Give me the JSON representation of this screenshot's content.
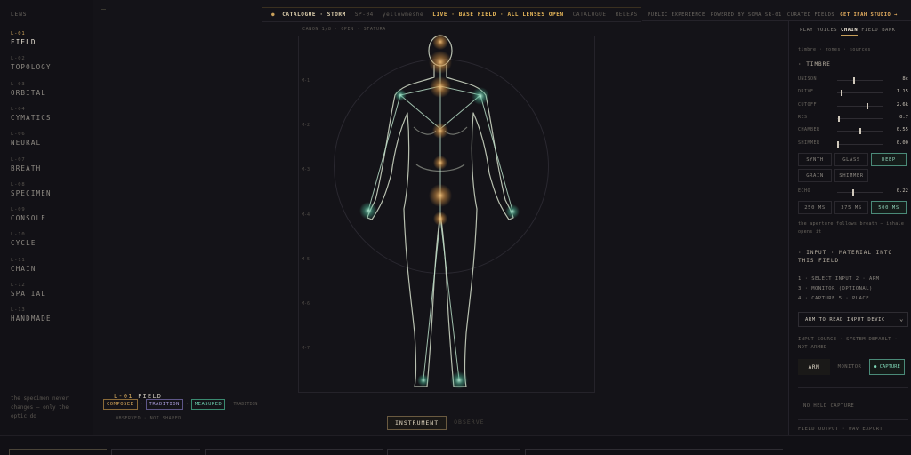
{
  "sidebar": {
    "heading": "LENS",
    "lenses": [
      {
        "code": "L-01",
        "name": "FIELD",
        "active": true
      },
      {
        "code": "L-02",
        "name": "TOPOLOGY"
      },
      {
        "code": "L-03",
        "name": "ORBITAL"
      },
      {
        "code": "L-04",
        "name": "CYMATICS"
      },
      {
        "code": "L-06",
        "name": "NEURAL"
      },
      {
        "code": "L-07",
        "name": "BREATH"
      },
      {
        "code": "L-08",
        "name": "SPECIMEN"
      },
      {
        "code": "L-09",
        "name": "CONSOLE"
      },
      {
        "code": "L-10",
        "name": "CYCLE"
      },
      {
        "code": "L-11",
        "name": "CHAIN"
      },
      {
        "code": "L-12",
        "name": "SPATIAL"
      },
      {
        "code": "L-13",
        "name": "HANDMADE"
      }
    ],
    "note": "the specimen never changes — only the optic do"
  },
  "topbar": {
    "catalogue": "CATALOGUE · STORM",
    "code": "SP-04",
    "tag": "yellowmeshe",
    "live": "LIVE · BASE FIELD · ALL LENSES OPEN",
    "catalogue_link": "CATALOGUE",
    "release": "RELEAS"
  },
  "rightbar": {
    "public": "PUBLIC EXPERIENCE",
    "powered": "POWERED BY SOMA SR-01",
    "curated": "CURATED FIELDS",
    "get": "GET IFAH STUDIO →"
  },
  "stage": {
    "canon": "CANON 1/8 · OPEN · STATURA",
    "ticks": [
      "M-1",
      "M-2",
      "M-3",
      "M-4",
      "M-5",
      "M-6",
      "M-7"
    ]
  },
  "legend": {
    "code": "L-01",
    "name": "FIELD",
    "chips": [
      "COMPOSED",
      "TRADITION",
      "MEASURED"
    ],
    "extra": "TRADITION",
    "sub": "OBSERVED · NOT SHAPED"
  },
  "modes": {
    "instrument": "INSTRUMENT",
    "observe": "OBSERVE"
  },
  "panel": {
    "tabs": [
      "PLAY",
      "VOICES",
      "CHAIN",
      "FIELD",
      "BANK"
    ],
    "active_tab": "CHAIN",
    "crumb": "timbre · zones · sources",
    "timbre_title": "· TIMBRE",
    "sliders": [
      {
        "label": "UNISON",
        "value": "8c",
        "pos": 0.36
      },
      {
        "label": "DRIVE",
        "value": "1.15",
        "pos": 0.08
      },
      {
        "label": "CUTOFF",
        "value": "2.6k",
        "pos": 0.66
      },
      {
        "label": "RES",
        "value": "0.7",
        "pos": 0.02
      },
      {
        "label": "CHAMBER",
        "value": "0.55",
        "pos": 0.5
      },
      {
        "label": "SHIMMER",
        "value": "0.00",
        "pos": 0.0
      }
    ],
    "wave_buttons": [
      "SYNTH",
      "GLASS",
      "DEEP"
    ],
    "wave_active": "DEEP",
    "wave_buttons2": [
      "GRAIN",
      "SHIMMER"
    ],
    "echo": {
      "label": "ECHO",
      "value": "0.22",
      "pos": 0.34
    },
    "echo_buttons": [
      "250 MS",
      "375 MS",
      "500 MS"
    ],
    "echo_active": "500 MS",
    "echo_note": "the aperture follows breath — inhale opens it",
    "input_title": "· INPUT · MATERIAL INTO THIS FIELD",
    "steps": [
      "1 · SELECT INPUT 2 · ARM",
      "3 · MONITOR (OPTIONAL)",
      "4 · CAPTURE 5 · PLACE"
    ],
    "select_value": "ARM TO READ INPUT DEVIC",
    "source_note": "INPUT SOURCE · SYSTEM DEFAULT · NOT ARMED",
    "arm": "ARM",
    "monitor": "MONITOR",
    "capture": "● CAPTURE",
    "no_held": "NO HELD CAPTURE",
    "field_output": "FIELD OUTPUT · WAV EXPORT"
  }
}
